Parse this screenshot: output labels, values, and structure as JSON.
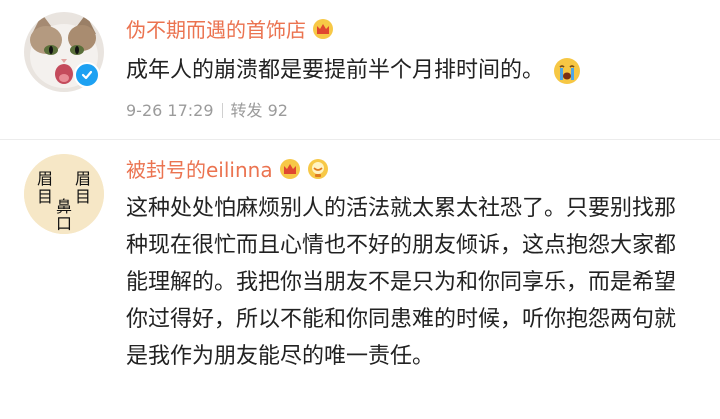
{
  "post1": {
    "username": "伪不期而遇的首饰店",
    "content": "成年人的崩溃都是要提前半个月排时间的。",
    "time": "9-26 17:29",
    "repost_label": "转发",
    "repost_count": "92",
    "badge_icon": "crown-badge-icon",
    "emoji_icon": "crying-face-icon",
    "verified_icon": "verified-check-icon"
  },
  "post2": {
    "username": "被封号的eilinna",
    "content": "这种处处怕麻烦别人的活法就太累太社恐了。只要别找那种现在很忙而且心情也不好的朋友倾诉，这点抱怨大家都能理解的。我把你当朋友不是只为和你同享乐，而是希望你过得好，所以不能和你同患难的时候，听你抱怨两句就是我作为朋友能尽的唯一责任。",
    "avatar_text": "眉目眉目鼻口",
    "badge_icons": [
      "crown-badge-icon",
      "fan-badge-icon"
    ]
  },
  "colors": {
    "username": "#eb7350",
    "text": "#222222",
    "meta": "#9b9b9b",
    "verified": "#1da1f2"
  }
}
